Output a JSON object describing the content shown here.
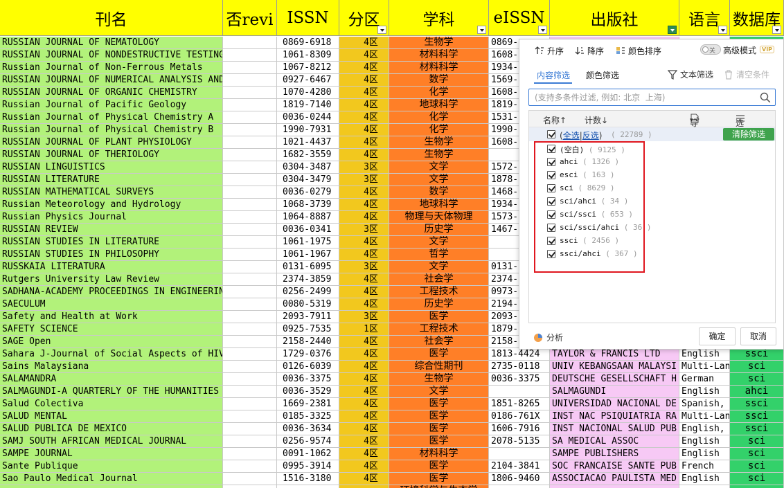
{
  "columns": [
    {
      "key": "name",
      "label": "刊名",
      "filter": false
    },
    {
      "key": "rev",
      "label": "否revi",
      "filter": false
    },
    {
      "key": "issn",
      "label": "ISSN",
      "filter": false
    },
    {
      "key": "zone",
      "label": "分区",
      "filter": true
    },
    {
      "key": "subj",
      "label": "学科",
      "filter": true
    },
    {
      "key": "eissn",
      "label": "eISSN",
      "filter": true
    },
    {
      "key": "pub",
      "label": "出版社",
      "filter": true,
      "active": true
    },
    {
      "key": "lang",
      "label": "语言",
      "filter": true
    },
    {
      "key": "db",
      "label": "数据库",
      "filter": true
    }
  ],
  "rows": [
    {
      "name": "RUSSIAN JOURNAL OF NEMATOLOGY",
      "issn": "0869-6918",
      "zone": "4区",
      "subj": "生物学",
      "eissn": "0869-",
      "pub": "",
      "lang": "",
      "db": ""
    },
    {
      "name": "RUSSIAN JOURNAL OF NONDESTRUCTIVE TESTING",
      "issn": "1061-8309",
      "zone": "4区",
      "subj": "材料科学",
      "eissn": "1608-",
      "pub": "",
      "lang": "",
      "db": ""
    },
    {
      "name": "Russian Journal of Non-Ferrous Metals",
      "issn": "1067-8212",
      "zone": "4区",
      "subj": "材料科学",
      "eissn": "1934-",
      "pub": "",
      "lang": "",
      "db": ""
    },
    {
      "name": "RUSSIAN JOURNAL OF NUMERICAL ANALYSIS AND MATHEMA",
      "issn": "0927-6467",
      "zone": "4区",
      "subj": "数学",
      "eissn": "1569-",
      "pub": "",
      "lang": "",
      "db": ""
    },
    {
      "name": "RUSSIAN JOURNAL OF ORGANIC CHEMISTRY",
      "issn": "1070-4280",
      "zone": "4区",
      "subj": "化学",
      "eissn": "1608-",
      "pub": "",
      "lang": "",
      "db": ""
    },
    {
      "name": "Russian Journal of Pacific Geology",
      "issn": "1819-7140",
      "zone": "4区",
      "subj": "地球科学",
      "eissn": "1819-",
      "pub": "",
      "lang": "",
      "db": ""
    },
    {
      "name": "Russian Journal of Physical Chemistry A",
      "issn": "0036-0244",
      "zone": "4区",
      "subj": "化学",
      "eissn": "1531-",
      "pub": "",
      "lang": "",
      "db": ""
    },
    {
      "name": "Russian Journal of Physical Chemistry B",
      "issn": "1990-7931",
      "zone": "4区",
      "subj": "化学",
      "eissn": "1990-",
      "pub": "",
      "lang": "",
      "db": ""
    },
    {
      "name": "RUSSIAN JOURNAL OF PLANT PHYSIOLOGY",
      "issn": "1021-4437",
      "zone": "4区",
      "subj": "生物学",
      "eissn": "1608-",
      "pub": "",
      "lang": "",
      "db": ""
    },
    {
      "name": "RUSSIAN JOURNAL OF THERIOLOGY",
      "issn": "1682-3559",
      "zone": "4区",
      "subj": "生物学",
      "eissn": "",
      "pub": "",
      "lang": "",
      "db": ""
    },
    {
      "name": "RUSSIAN LINGUISTICS",
      "issn": "0304-3487",
      "zone": "3区",
      "subj": "文学",
      "eissn": "1572-",
      "pub": "",
      "lang": "",
      "db": ""
    },
    {
      "name": "RUSSIAN LITERATURE",
      "issn": "0304-3479",
      "zone": "3区",
      "subj": "文学",
      "eissn": "1878-",
      "pub": "",
      "lang": "",
      "db": ""
    },
    {
      "name": "RUSSIAN MATHEMATICAL SURVEYS",
      "issn": "0036-0279",
      "zone": "4区",
      "subj": "数学",
      "eissn": "1468-",
      "pub": "",
      "lang": "",
      "db": ""
    },
    {
      "name": "Russian Meteorology and Hydrology",
      "issn": "1068-3739",
      "zone": "4区",
      "subj": "地球科学",
      "eissn": "1934-",
      "pub": "",
      "lang": "",
      "db": ""
    },
    {
      "name": "Russian Physics Journal",
      "issn": "1064-8887",
      "zone": "4区",
      "subj": "物理与天体物理",
      "eissn": "1573-",
      "pub": "",
      "lang": "",
      "db": ""
    },
    {
      "name": "RUSSIAN REVIEW",
      "issn": "0036-0341",
      "zone": "3区",
      "subj": "历史学",
      "eissn": "1467-",
      "pub": "",
      "lang": "",
      "db": ""
    },
    {
      "name": "RUSSIAN STUDIES IN LITERATURE",
      "issn": "1061-1975",
      "zone": "4区",
      "subj": "文学",
      "eissn": "",
      "pub": "",
      "lang": "",
      "db": ""
    },
    {
      "name": "RUSSIAN STUDIES IN PHILOSOPHY",
      "issn": "1061-1967",
      "zone": "4区",
      "subj": "哲学",
      "eissn": "",
      "pub": "",
      "lang": "",
      "db": ""
    },
    {
      "name": "RUSSKAIA LITERATURA",
      "issn": "0131-6095",
      "zone": "3区",
      "subj": "文学",
      "eissn": "0131-",
      "pub": "",
      "lang": "",
      "db": ""
    },
    {
      "name": "Rutgers University Law Review",
      "issn": "2374-3859",
      "zone": "4区",
      "subj": "社会学",
      "eissn": "2374-",
      "pub": "",
      "lang": "",
      "db": ""
    },
    {
      "name": "SADHANA-ACADEMY PROCEEDINGS IN ENGINEERING SCIENC",
      "issn": "0256-2499",
      "zone": "4区",
      "subj": "工程技术",
      "eissn": "0973-",
      "pub": "",
      "lang": "",
      "db": ""
    },
    {
      "name": "SAECULUM",
      "issn": "0080-5319",
      "zone": "4区",
      "subj": "历史学",
      "eissn": "2194-",
      "pub": "",
      "lang": "",
      "db": ""
    },
    {
      "name": "Safety and Health at Work",
      "issn": "2093-7911",
      "zone": "3区",
      "subj": "医学",
      "eissn": "2093-",
      "pub": "",
      "lang": "",
      "db": ""
    },
    {
      "name": "SAFETY SCIENCE",
      "issn": "0925-7535",
      "zone": "1区",
      "subj": "工程技术",
      "eissn": "1879-",
      "pub": "",
      "lang": "",
      "db": ""
    },
    {
      "name": "SAGE Open",
      "issn": "2158-2440",
      "zone": "4区",
      "subj": "社会学",
      "eissn": "2158-",
      "pub": "",
      "lang": "",
      "db": ""
    },
    {
      "name": "Sahara J-Journal of Social Aspects of HIV-AIDS",
      "issn": "1729-0376",
      "zone": "4区",
      "subj": "医学",
      "eissn": "1813-4424",
      "pub": "TAYLOR & FRANCIS LTD",
      "lang": "English",
      "db": "ssci"
    },
    {
      "name": "Sains Malaysiana",
      "issn": "0126-6039",
      "zone": "4区",
      "subj": "综合性期刊",
      "eissn": "2735-0118",
      "pub": "UNIV KEBANGSAAN MALAYSI",
      "lang": "Multi-Lan",
      "db": "sci"
    },
    {
      "name": "SALAMANDRA",
      "issn": "0036-3375",
      "zone": "4区",
      "subj": "生物学",
      "eissn": "0036-3375",
      "pub": "DEUTSCHE GESELLSCHAFT H",
      "lang": "German",
      "db": "sci"
    },
    {
      "name": "SALMAGUNDI-A QUARTERLY OF THE HUMANITIES AND SOCI",
      "issn": "0036-3529",
      "zone": "4区",
      "subj": "文学",
      "eissn": "",
      "pub": "SALMAGUNDI",
      "lang": "English",
      "db": "ahci"
    },
    {
      "name": "Salud Colectiva",
      "issn": "1669-2381",
      "zone": "4区",
      "subj": "医学",
      "eissn": "1851-8265",
      "pub": "UNIVERSIDAD NACIONAL DE",
      "lang": "Spanish,",
      "db": "ssci"
    },
    {
      "name": "SALUD MENTAL",
      "issn": "0185-3325",
      "zone": "4区",
      "subj": "医学",
      "eissn": "0186-761X",
      "pub": "INST NAC PSIQUIATRIA RA",
      "lang": "Multi-Lan",
      "db": "ssci"
    },
    {
      "name": "SALUD PUBLICA DE MEXICO",
      "issn": "0036-3634",
      "zone": "4区",
      "subj": "医学",
      "eissn": "1606-7916",
      "pub": "INST NACIONAL SALUD PUB",
      "lang": "English,",
      "db": "ssci"
    },
    {
      "name": "SAMJ SOUTH AFRICAN MEDICAL JOURNAL",
      "issn": "0256-9574",
      "zone": "4区",
      "subj": "医学",
      "eissn": "2078-5135",
      "pub": "SA MEDICAL ASSOC",
      "lang": "English",
      "db": "sci"
    },
    {
      "name": "SAMPE JOURNAL",
      "issn": "0091-1062",
      "zone": "4区",
      "subj": "材料科学",
      "eissn": "",
      "pub": "SAMPE PUBLISHERS",
      "lang": "English",
      "db": "sci"
    },
    {
      "name": "Sante Publique",
      "issn": "0995-3914",
      "zone": "4区",
      "subj": "医学",
      "eissn": "2104-3841",
      "pub": "SOC FRANCAISE SANTE PUB",
      "lang": "French",
      "db": "sci"
    },
    {
      "name": "Sao Paulo Medical Journal",
      "issn": "1516-3180",
      "zone": "4区",
      "subj": "医学",
      "eissn": "1806-9460",
      "pub": "ASSOCIACAO PAULISTA MED",
      "lang": "English",
      "db": "sci"
    },
    {
      "name": "",
      "issn": "",
      "zone": "",
      "subj": "环境科学与生态学",
      "eissn": "",
      "pub": "",
      "lang": "",
      "db": ""
    }
  ],
  "panel": {
    "sort_asc": "升序",
    "sort_desc": "降序",
    "sort_color": "颜色排序",
    "toggle_text": "关",
    "advanced": "高级模式",
    "vip": "VIP",
    "tab_content": "内容筛选",
    "tab_color": "颜色筛选",
    "text_filter": "文本筛选",
    "clear_cond": "清空条件",
    "search_placeholder": "(支持多条件过滤, 例如: 北京  上海)",
    "col_name": "名称↑",
    "col_count": "计数↓",
    "export": "导出",
    "options": "选项",
    "select_all": "全选",
    "invert": "反选",
    "all_count": "( 22789 )",
    "clear_filter": "清除筛选",
    "items": [
      {
        "label": "(空白)",
        "count": "( 9125 )"
      },
      {
        "label": "ahci",
        "count": "( 1326 )"
      },
      {
        "label": "esci",
        "count": "( 163 )"
      },
      {
        "label": "sci",
        "count": "( 8629 )"
      },
      {
        "label": "sci/ahci",
        "count": "( 34 )"
      },
      {
        "label": "sci/ssci",
        "count": "( 653 )"
      },
      {
        "label": "sci/ssci/ahci",
        "count": "( 36 )"
      },
      {
        "label": "ssci",
        "count": "( 2456 )"
      },
      {
        "label": "ssci/ahci",
        "count": "( 367 )"
      }
    ],
    "analyze": "分析",
    "ok": "确定",
    "cancel": "取消"
  }
}
